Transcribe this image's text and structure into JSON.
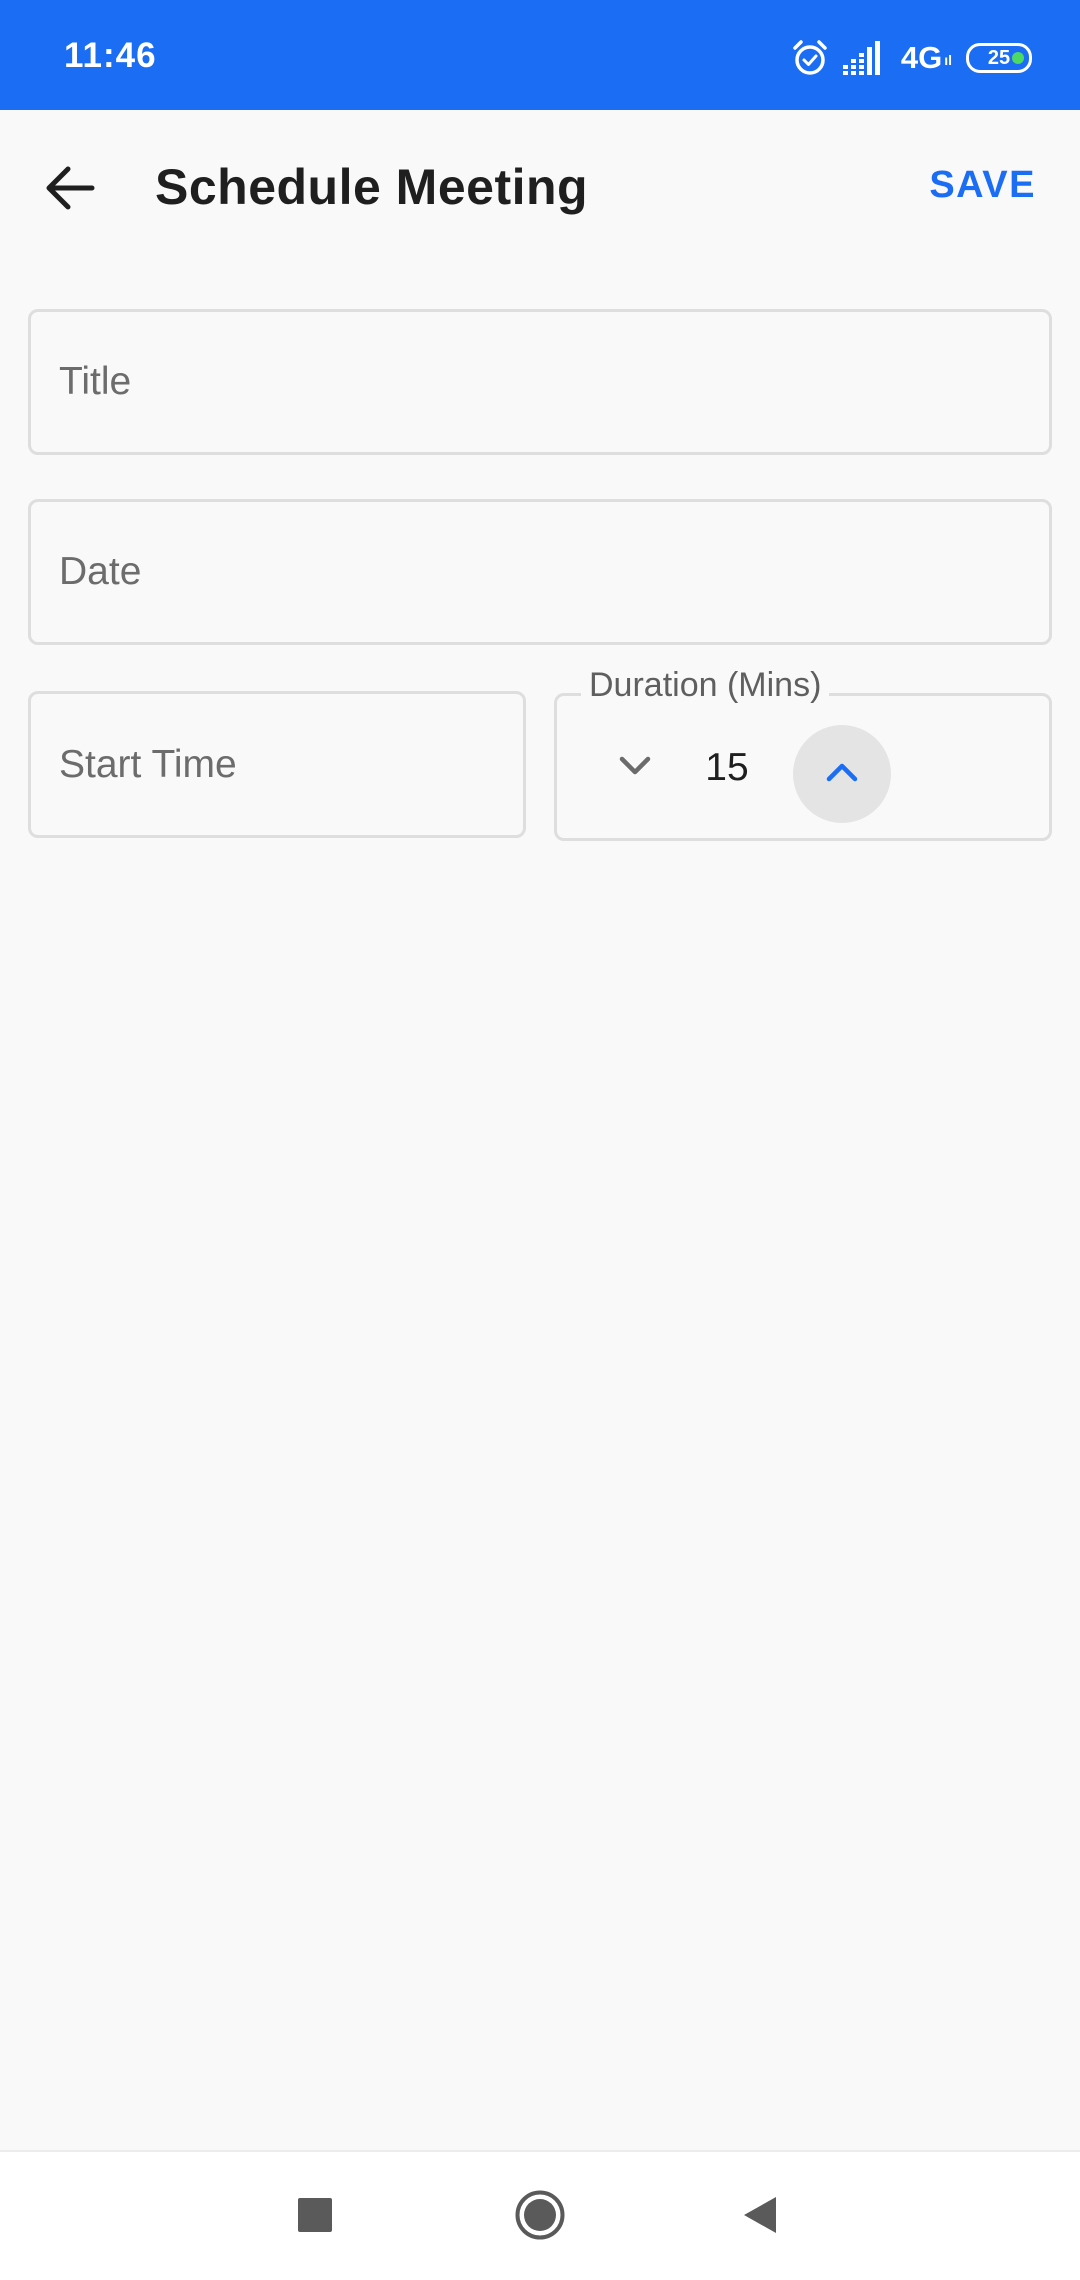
{
  "status_bar": {
    "time": "11:46",
    "network": "4G",
    "network_sub": "ıl",
    "battery": "25",
    "icons": [
      "alarm-icon",
      "signal-icon",
      "battery-icon"
    ],
    "accent_color": "#1b6ef3"
  },
  "header": {
    "title": "Schedule Meeting",
    "back_icon": "arrow-left-icon",
    "save_label": "SAVE"
  },
  "form": {
    "title_placeholder": "Title",
    "date_placeholder": "Date",
    "start_time_placeholder": "Start Time",
    "duration": {
      "label": "Duration (Mins)",
      "value": "15",
      "decrement_icon": "chevron-down-icon",
      "increment_icon": "chevron-up-icon"
    }
  },
  "nav_bar": {
    "recents_icon": "square-icon",
    "home_icon": "circle-icon",
    "back_icon": "triangle-back-icon"
  }
}
